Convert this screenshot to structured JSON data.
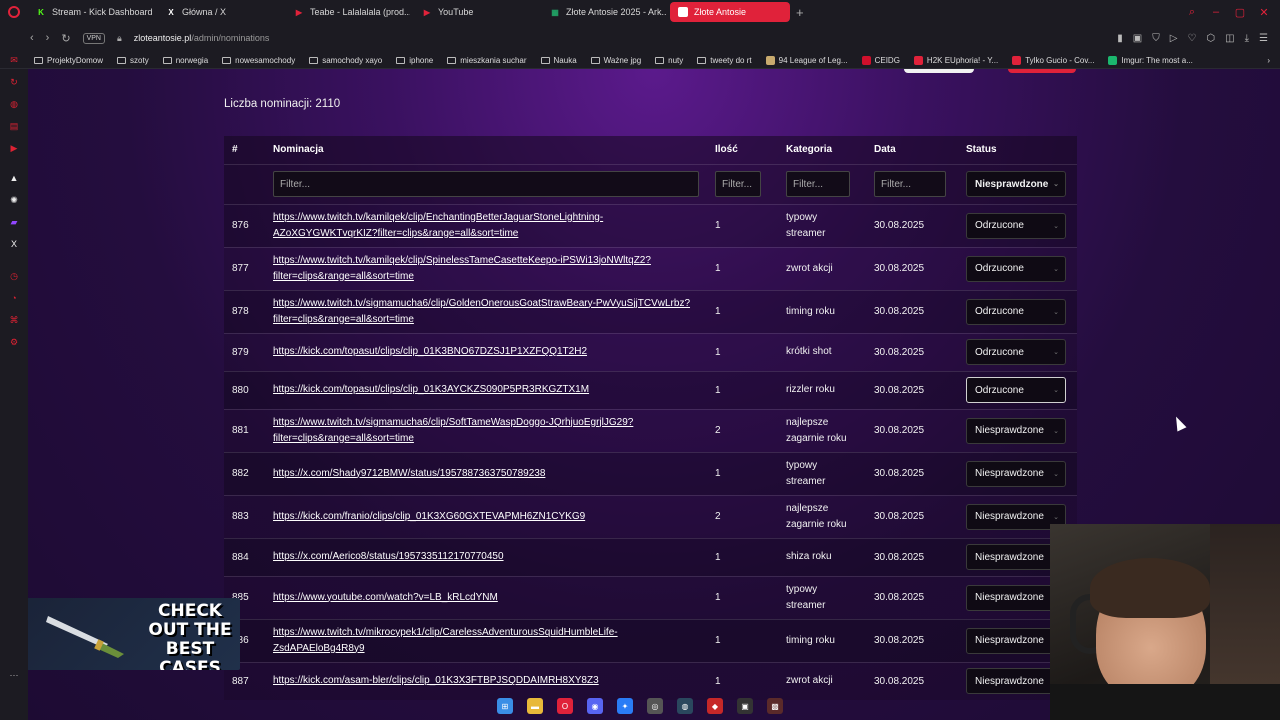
{
  "tabs": [
    {
      "label": "Stream - Kick Dashboard",
      "favicon": "kick-icon",
      "color": "#53fc18",
      "glyph": "K"
    },
    {
      "label": "Główna / X",
      "favicon": "x-icon",
      "color": "#ffffff",
      "glyph": "X"
    },
    {
      "label": "Teabe - Lalalalala (prod...",
      "favicon": "youtube-icon",
      "color": "#e0223a",
      "glyph": "▶"
    },
    {
      "label": "YouTube",
      "favicon": "youtube-icon",
      "color": "#e0223a",
      "glyph": "▶"
    },
    {
      "label": "Złote Antosie 2025 - Ark...",
      "favicon": "sheets-icon",
      "color": "#21a366",
      "glyph": "▦"
    },
    {
      "label": "Złote Antosie",
      "favicon": "zlote-antosie-icon",
      "color": "#ffffff",
      "glyph": "◆"
    }
  ],
  "address": {
    "vpn": "VPN",
    "domain": "zloteantosie.pl",
    "path": "/admin/nominations"
  },
  "bookmarks": [
    {
      "label": "ProjektyDomow",
      "type": "folder"
    },
    {
      "label": "szoty",
      "type": "folder"
    },
    {
      "label": "norwegia",
      "type": "folder"
    },
    {
      "label": "nowesamochody",
      "type": "folder"
    },
    {
      "label": "samochody xayo",
      "type": "folder"
    },
    {
      "label": "iphone",
      "type": "folder"
    },
    {
      "label": "mieszkania suchar",
      "type": "folder"
    },
    {
      "label": "Nauka",
      "type": "folder"
    },
    {
      "label": "Ważne jpg",
      "type": "folder"
    },
    {
      "label": "nuty",
      "type": "folder"
    },
    {
      "label": "tweety do rt",
      "type": "folder"
    },
    {
      "label": "94 League of Leg...",
      "type": "site",
      "color": "#c8aa6e"
    },
    {
      "label": "CEIDG",
      "type": "site",
      "color": "#d0102c"
    },
    {
      "label": "H2K EUphoria! - Y...",
      "type": "site",
      "color": "#e0223a"
    },
    {
      "label": "Tylko Gucio - Cov...",
      "type": "site",
      "color": "#e0223a"
    },
    {
      "label": "Imgur: The most a...",
      "type": "site",
      "color": "#1bb76e"
    }
  ],
  "page": {
    "count_label": "Liczba nominacji: 2110",
    "headers": {
      "num": "#",
      "nomination": "Nominacja",
      "qty": "Ilość",
      "category": "Kategoria",
      "date": "Data",
      "status": "Status"
    },
    "filter_placeholder": "Filter...",
    "status_filter_value": "Niesprawdzone"
  },
  "rows": [
    {
      "num": "876",
      "link": "https://www.twitch.tv/kamilqek/clip/EnchantingBetterJaguarStoneLightning-AZoXGYGWKTvqrKIZ?filter=clips&range=all&sort=time",
      "qty": "1",
      "category": "typowy streamer",
      "date": "30.08.2025",
      "status": "Odrzucone"
    },
    {
      "num": "877",
      "link": "https://www.twitch.tv/kamilqek/clip/SpinelessTameCasetteKeepo-iPSWi13joNWltqZ2?filter=clips&range=all&sort=time",
      "qty": "1",
      "category": "zwrot akcji",
      "date": "30.08.2025",
      "status": "Odrzucone"
    },
    {
      "num": "878",
      "link": "https://www.twitch.tv/sigmamucha6/clip/GoldenOnerousGoatStrawBeary-PwVyuSjjTCVwLrbz?filter=clips&range=all&sort=time",
      "qty": "1",
      "category": "timing roku",
      "date": "30.08.2025",
      "status": "Odrzucone"
    },
    {
      "num": "879",
      "link": "https://kick.com/topasut/clips/clip_01K3BNO67DZSJ1P1XZFQQ1T2H2",
      "qty": "1",
      "category": "krótki shot",
      "date": "30.08.2025",
      "status": "Odrzucone"
    },
    {
      "num": "880",
      "link": "https://kick.com/topasut/clips/clip_01K3AYCKZS090P5PR3RKGZTX1M",
      "qty": "1",
      "category": "rizzler roku",
      "date": "30.08.2025",
      "status": "Odrzucone"
    },
    {
      "num": "881",
      "link": "https://www.twitch.tv/sigmamucha6/clip/SoftTameWaspDoggo-JQrhjuoEgrjlJG29?filter=clips&range=all&sort=time",
      "qty": "2",
      "category": "najlepsze zagarnie roku",
      "date": "30.08.2025",
      "status": "Niesprawdzone"
    },
    {
      "num": "882",
      "link": "https://x.com/Shady9712BMW/status/1957887363750789238",
      "qty": "1",
      "category": "typowy streamer",
      "date": "30.08.2025",
      "status": "Niesprawdzone"
    },
    {
      "num": "883",
      "link": "https://kick.com/franio/clips/clip_01K3XG60GXTEVAPMH6ZN1CYKG9",
      "qty": "2",
      "category": "najlepsze zagarnie roku",
      "date": "30.08.2025",
      "status": "Niesprawdzone"
    },
    {
      "num": "884",
      "link": "https://x.com/Aerico8/status/1957335112170770450",
      "qty": "1",
      "category": "shiza roku",
      "date": "30.08.2025",
      "status": "Niesprawdzone"
    },
    {
      "num": "885",
      "link": "https://www.youtube.com/watch?v=LB_kRLcdYNM",
      "qty": "1",
      "category": "typowy streamer",
      "date": "30.08.2025",
      "status": "Niesprawdzone"
    },
    {
      "num": "886",
      "link": "https://www.twitch.tv/mikrocypek1/clip/CarelessAdventurousSquidHumbleLife-ZsdAPAEloBg4R8y9",
      "qty": "1",
      "category": "timing roku",
      "date": "30.08.2025",
      "status": "Niesprawdzone"
    },
    {
      "num": "887",
      "link": "https://kick.com/asam-bler/clips/clip_01K3X3FTBPJSQDDAIMRH8XY8Z3",
      "qty": "1",
      "category": "zwrot akcji",
      "date": "30.08.2025",
      "status": "Niesprawdzone"
    }
  ],
  "overlay_ad": {
    "text": "CHECK OUT THE BEST CASES"
  },
  "taskbar": [
    {
      "name": "windows-start-icon",
      "color": "#3a8ee6",
      "glyph": "⊞"
    },
    {
      "name": "file-explorer-icon",
      "color": "#e8b93a",
      "glyph": "▬"
    },
    {
      "name": "opera-gx-icon",
      "color": "#e0223a",
      "glyph": "O"
    },
    {
      "name": "discord-icon",
      "color": "#5865f2",
      "glyph": "◉"
    },
    {
      "name": "messenger-icon",
      "color": "#2a7cf6",
      "glyph": "✦"
    },
    {
      "name": "obs-icon",
      "color": "#555555",
      "glyph": "◎"
    },
    {
      "name": "steam-icon",
      "color": "#2a475e",
      "glyph": "◍"
    },
    {
      "name": "game-icon",
      "color": "#c62828",
      "glyph": "◆"
    },
    {
      "name": "app-icon",
      "color": "#333333",
      "glyph": "▣"
    },
    {
      "name": "app2-icon",
      "color": "#5a2a2a",
      "glyph": "▩"
    }
  ]
}
